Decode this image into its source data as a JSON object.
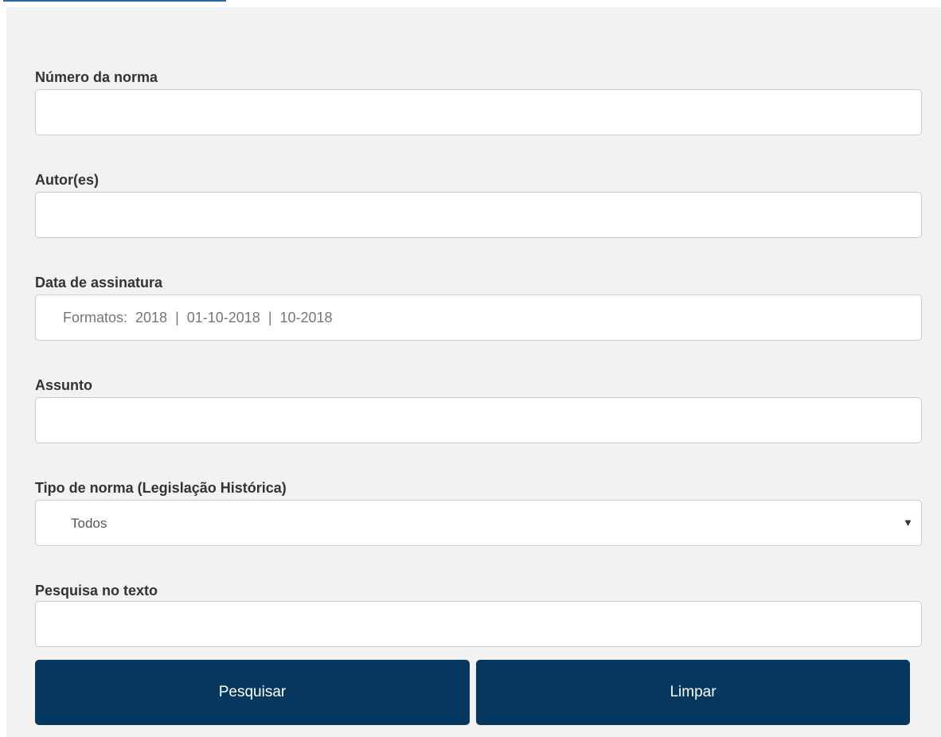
{
  "form": {
    "fields": [
      {
        "label": "Número da norma",
        "value": "",
        "placeholder": ""
      },
      {
        "label": "Autor(es)",
        "value": "",
        "placeholder": ""
      },
      {
        "label": "Data de assinatura",
        "value": "",
        "placeholder": "Formatos:  2018  |  01-10-2018  |  10-2018"
      },
      {
        "label": "Assunto",
        "value": "",
        "placeholder": ""
      },
      {
        "label": "Tipo de norma (Legislação Histórica)",
        "selected": "Todos"
      },
      {
        "label": "Pesquisa no texto",
        "value": "",
        "placeholder": ""
      }
    ],
    "icons": {
      "select_caret": "caret-down-icon"
    },
    "buttons": {
      "search": "Pesquisar",
      "clear": "Limpar"
    }
  },
  "colors": {
    "panel_background": "#f2f2f2",
    "button_background": "#06375e",
    "button_text": "#ffffff",
    "input_border": "#cccccc"
  }
}
